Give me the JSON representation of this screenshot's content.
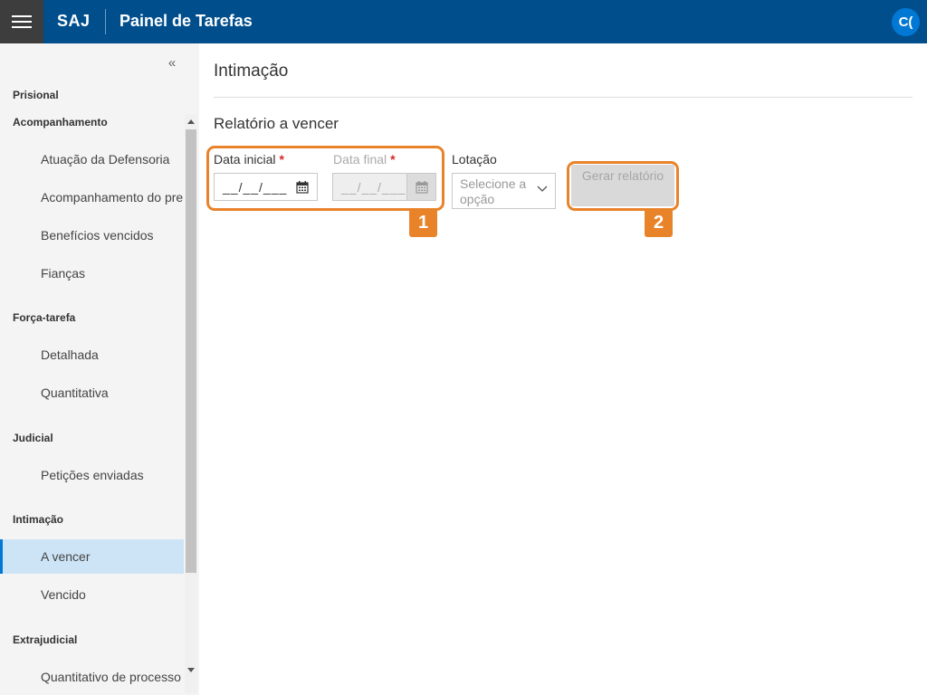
{
  "header": {
    "brand": "SAJ",
    "title": "Painel de Tarefas",
    "avatar_initials": "C("
  },
  "sidebar": {
    "collapse_icon": "«",
    "categories": {
      "prisional": "Prisional",
      "acompanhamento": "Acompanhamento",
      "forca_tarefa": "Força-tarefa",
      "judicial": "Judicial",
      "intimacao": "Intimação",
      "extrajudicial": "Extrajudicial"
    },
    "items": {
      "atuacao": "Atuação da Defensoria",
      "acompanhamento_pre": "Acompanhamento do pre",
      "beneficios": "Benefícios vencidos",
      "fiancas": "Fianças",
      "detalhada": "Detalhada",
      "quantitativa": "Quantitativa",
      "peticoes": "Petições enviadas",
      "a_vencer": "A vencer",
      "vencido": "Vencido",
      "quantitativo_processo": "Quantitativo de processo"
    },
    "active_item": "A vencer"
  },
  "main": {
    "page_title": "Intimação",
    "section_title": "Relatório a vencer",
    "form": {
      "data_inicial_label": "Data inicial",
      "data_final_label": "Data final",
      "required_mark": "*",
      "data_inicial_value": "__/__/___",
      "data_final_value": "__/__/___",
      "lotacao_label": "Lotação",
      "lotacao_placeholder": "Selecione a opção",
      "generate_button": "Gerar relatório"
    }
  },
  "callouts": {
    "badge_1": "1",
    "badge_2": "2"
  },
  "colors": {
    "header_bg": "#004e8c",
    "hamburger_bg": "#3d3d3d",
    "avatar_bg": "#0078d4",
    "active_item_bg": "#cde4f6",
    "callout": "#e8832a",
    "required": "#d62929"
  },
  "icons": {
    "menu": "hamburger-menu-icon",
    "collapse": "double-chevron-left-icon",
    "calendar": "calendar-icon",
    "dropdown": "chevron-down-icon"
  }
}
